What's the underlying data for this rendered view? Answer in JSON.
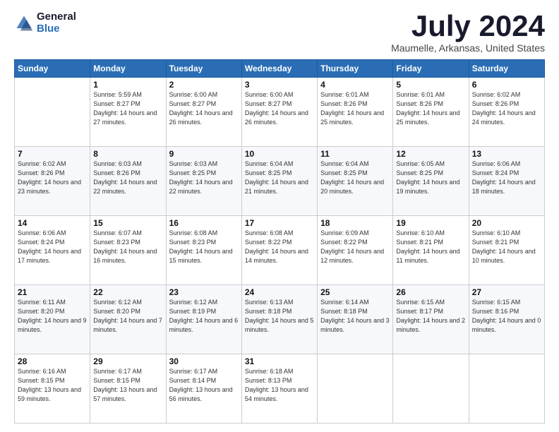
{
  "header": {
    "logo_general": "General",
    "logo_blue": "Blue",
    "month_title": "July 2024",
    "location": "Maumelle, Arkansas, United States"
  },
  "days_of_week": [
    "Sunday",
    "Monday",
    "Tuesday",
    "Wednesday",
    "Thursday",
    "Friday",
    "Saturday"
  ],
  "weeks": [
    [
      {
        "day": "",
        "sunrise": "",
        "sunset": "",
        "daylight": ""
      },
      {
        "day": "1",
        "sunrise": "Sunrise: 5:59 AM",
        "sunset": "Sunset: 8:27 PM",
        "daylight": "Daylight: 14 hours and 27 minutes."
      },
      {
        "day": "2",
        "sunrise": "Sunrise: 6:00 AM",
        "sunset": "Sunset: 8:27 PM",
        "daylight": "Daylight: 14 hours and 26 minutes."
      },
      {
        "day": "3",
        "sunrise": "Sunrise: 6:00 AM",
        "sunset": "Sunset: 8:27 PM",
        "daylight": "Daylight: 14 hours and 26 minutes."
      },
      {
        "day": "4",
        "sunrise": "Sunrise: 6:01 AM",
        "sunset": "Sunset: 8:26 PM",
        "daylight": "Daylight: 14 hours and 25 minutes."
      },
      {
        "day": "5",
        "sunrise": "Sunrise: 6:01 AM",
        "sunset": "Sunset: 8:26 PM",
        "daylight": "Daylight: 14 hours and 25 minutes."
      },
      {
        "day": "6",
        "sunrise": "Sunrise: 6:02 AM",
        "sunset": "Sunset: 8:26 PM",
        "daylight": "Daylight: 14 hours and 24 minutes."
      }
    ],
    [
      {
        "day": "7",
        "sunrise": "Sunrise: 6:02 AM",
        "sunset": "Sunset: 8:26 PM",
        "daylight": "Daylight: 14 hours and 23 minutes."
      },
      {
        "day": "8",
        "sunrise": "Sunrise: 6:03 AM",
        "sunset": "Sunset: 8:26 PM",
        "daylight": "Daylight: 14 hours and 22 minutes."
      },
      {
        "day": "9",
        "sunrise": "Sunrise: 6:03 AM",
        "sunset": "Sunset: 8:25 PM",
        "daylight": "Daylight: 14 hours and 22 minutes."
      },
      {
        "day": "10",
        "sunrise": "Sunrise: 6:04 AM",
        "sunset": "Sunset: 8:25 PM",
        "daylight": "Daylight: 14 hours and 21 minutes."
      },
      {
        "day": "11",
        "sunrise": "Sunrise: 6:04 AM",
        "sunset": "Sunset: 8:25 PM",
        "daylight": "Daylight: 14 hours and 20 minutes."
      },
      {
        "day": "12",
        "sunrise": "Sunrise: 6:05 AM",
        "sunset": "Sunset: 8:25 PM",
        "daylight": "Daylight: 14 hours and 19 minutes."
      },
      {
        "day": "13",
        "sunrise": "Sunrise: 6:06 AM",
        "sunset": "Sunset: 8:24 PM",
        "daylight": "Daylight: 14 hours and 18 minutes."
      }
    ],
    [
      {
        "day": "14",
        "sunrise": "Sunrise: 6:06 AM",
        "sunset": "Sunset: 8:24 PM",
        "daylight": "Daylight: 14 hours and 17 minutes."
      },
      {
        "day": "15",
        "sunrise": "Sunrise: 6:07 AM",
        "sunset": "Sunset: 8:23 PM",
        "daylight": "Daylight: 14 hours and 16 minutes."
      },
      {
        "day": "16",
        "sunrise": "Sunrise: 6:08 AM",
        "sunset": "Sunset: 8:23 PM",
        "daylight": "Daylight: 14 hours and 15 minutes."
      },
      {
        "day": "17",
        "sunrise": "Sunrise: 6:08 AM",
        "sunset": "Sunset: 8:22 PM",
        "daylight": "Daylight: 14 hours and 14 minutes."
      },
      {
        "day": "18",
        "sunrise": "Sunrise: 6:09 AM",
        "sunset": "Sunset: 8:22 PM",
        "daylight": "Daylight: 14 hours and 12 minutes."
      },
      {
        "day": "19",
        "sunrise": "Sunrise: 6:10 AM",
        "sunset": "Sunset: 8:21 PM",
        "daylight": "Daylight: 14 hours and 11 minutes."
      },
      {
        "day": "20",
        "sunrise": "Sunrise: 6:10 AM",
        "sunset": "Sunset: 8:21 PM",
        "daylight": "Daylight: 14 hours and 10 minutes."
      }
    ],
    [
      {
        "day": "21",
        "sunrise": "Sunrise: 6:11 AM",
        "sunset": "Sunset: 8:20 PM",
        "daylight": "Daylight: 14 hours and 9 minutes."
      },
      {
        "day": "22",
        "sunrise": "Sunrise: 6:12 AM",
        "sunset": "Sunset: 8:20 PM",
        "daylight": "Daylight: 14 hours and 7 minutes."
      },
      {
        "day": "23",
        "sunrise": "Sunrise: 6:12 AM",
        "sunset": "Sunset: 8:19 PM",
        "daylight": "Daylight: 14 hours and 6 minutes."
      },
      {
        "day": "24",
        "sunrise": "Sunrise: 6:13 AM",
        "sunset": "Sunset: 8:18 PM",
        "daylight": "Daylight: 14 hours and 5 minutes."
      },
      {
        "day": "25",
        "sunrise": "Sunrise: 6:14 AM",
        "sunset": "Sunset: 8:18 PM",
        "daylight": "Daylight: 14 hours and 3 minutes."
      },
      {
        "day": "26",
        "sunrise": "Sunrise: 6:15 AM",
        "sunset": "Sunset: 8:17 PM",
        "daylight": "Daylight: 14 hours and 2 minutes."
      },
      {
        "day": "27",
        "sunrise": "Sunrise: 6:15 AM",
        "sunset": "Sunset: 8:16 PM",
        "daylight": "Daylight: 14 hours and 0 minutes."
      }
    ],
    [
      {
        "day": "28",
        "sunrise": "Sunrise: 6:16 AM",
        "sunset": "Sunset: 8:15 PM",
        "daylight": "Daylight: 13 hours and 59 minutes."
      },
      {
        "day": "29",
        "sunrise": "Sunrise: 6:17 AM",
        "sunset": "Sunset: 8:15 PM",
        "daylight": "Daylight: 13 hours and 57 minutes."
      },
      {
        "day": "30",
        "sunrise": "Sunrise: 6:17 AM",
        "sunset": "Sunset: 8:14 PM",
        "daylight": "Daylight: 13 hours and 56 minutes."
      },
      {
        "day": "31",
        "sunrise": "Sunrise: 6:18 AM",
        "sunset": "Sunset: 8:13 PM",
        "daylight": "Daylight: 13 hours and 54 minutes."
      },
      {
        "day": "",
        "sunrise": "",
        "sunset": "",
        "daylight": ""
      },
      {
        "day": "",
        "sunrise": "",
        "sunset": "",
        "daylight": ""
      },
      {
        "day": "",
        "sunrise": "",
        "sunset": "",
        "daylight": ""
      }
    ]
  ]
}
